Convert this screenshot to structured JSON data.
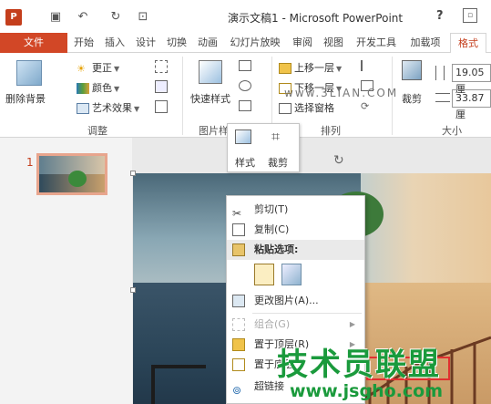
{
  "app": {
    "title": "演示文稿1 - Microsoft PowerPoint",
    "icon_text": "P",
    "help": "?",
    "qat_icons": [
      "save-icon",
      "undo-icon",
      "redo-icon",
      "present-icon"
    ]
  },
  "tabs": [
    {
      "label": "文件"
    },
    {
      "label": "开始"
    },
    {
      "label": "插入"
    },
    {
      "label": "设计"
    },
    {
      "label": "切换"
    },
    {
      "label": "动画"
    },
    {
      "label": "幻灯片放映"
    },
    {
      "label": "审阅"
    },
    {
      "label": "视图"
    },
    {
      "label": "开发工具"
    },
    {
      "label": "加载项"
    },
    {
      "label": "格式"
    }
  ],
  "ribbon": {
    "remove_bg": "删除背景",
    "corrections": "更正",
    "color": "颜色",
    "artistic": "艺术效果",
    "group_adjust": "调整",
    "quick_styles": "快速样式",
    "group_picture": "图片样",
    "bring_forward": "上移一层",
    "send_backward": "下移一层",
    "selection_pane": "选择窗格",
    "group_arrange": "排列",
    "crop": "裁剪",
    "height": "19.05 厘",
    "width": "33.87 厘",
    "group_size": "大小"
  },
  "slides": [
    {
      "number": "1"
    }
  ],
  "mini_toolbar": {
    "style": "样式",
    "crop": "裁剪"
  },
  "context_menu": [
    {
      "label": "剪切(T)",
      "icon": "scissors-icon",
      "enabled": true
    },
    {
      "label": "复制(C)",
      "icon": "copy-icon",
      "enabled": true
    },
    {
      "label": "粘贴选项:",
      "icon": "paste-icon",
      "enabled": true,
      "header": true
    },
    {
      "label": "更改图片(A)...",
      "icon": "change-picture-icon",
      "enabled": true
    },
    {
      "label": "组合(G)",
      "icon": "group-icon",
      "enabled": false
    },
    {
      "label": "置于顶层(R)",
      "icon": "bring-to-front-icon",
      "enabled": true
    },
    {
      "label": "置于底层",
      "icon": "send-to-back-icon",
      "enabled": true
    },
    {
      "label": "超链接",
      "icon": "hyperlink-icon",
      "enabled": true
    }
  ],
  "watermarks": {
    "top": "www.3LIAN.COM",
    "big": "技术员联盟",
    "url": "www.jsgho.com"
  },
  "colors": {
    "accent": "#d24726",
    "watermark": "#1a9a3c"
  }
}
